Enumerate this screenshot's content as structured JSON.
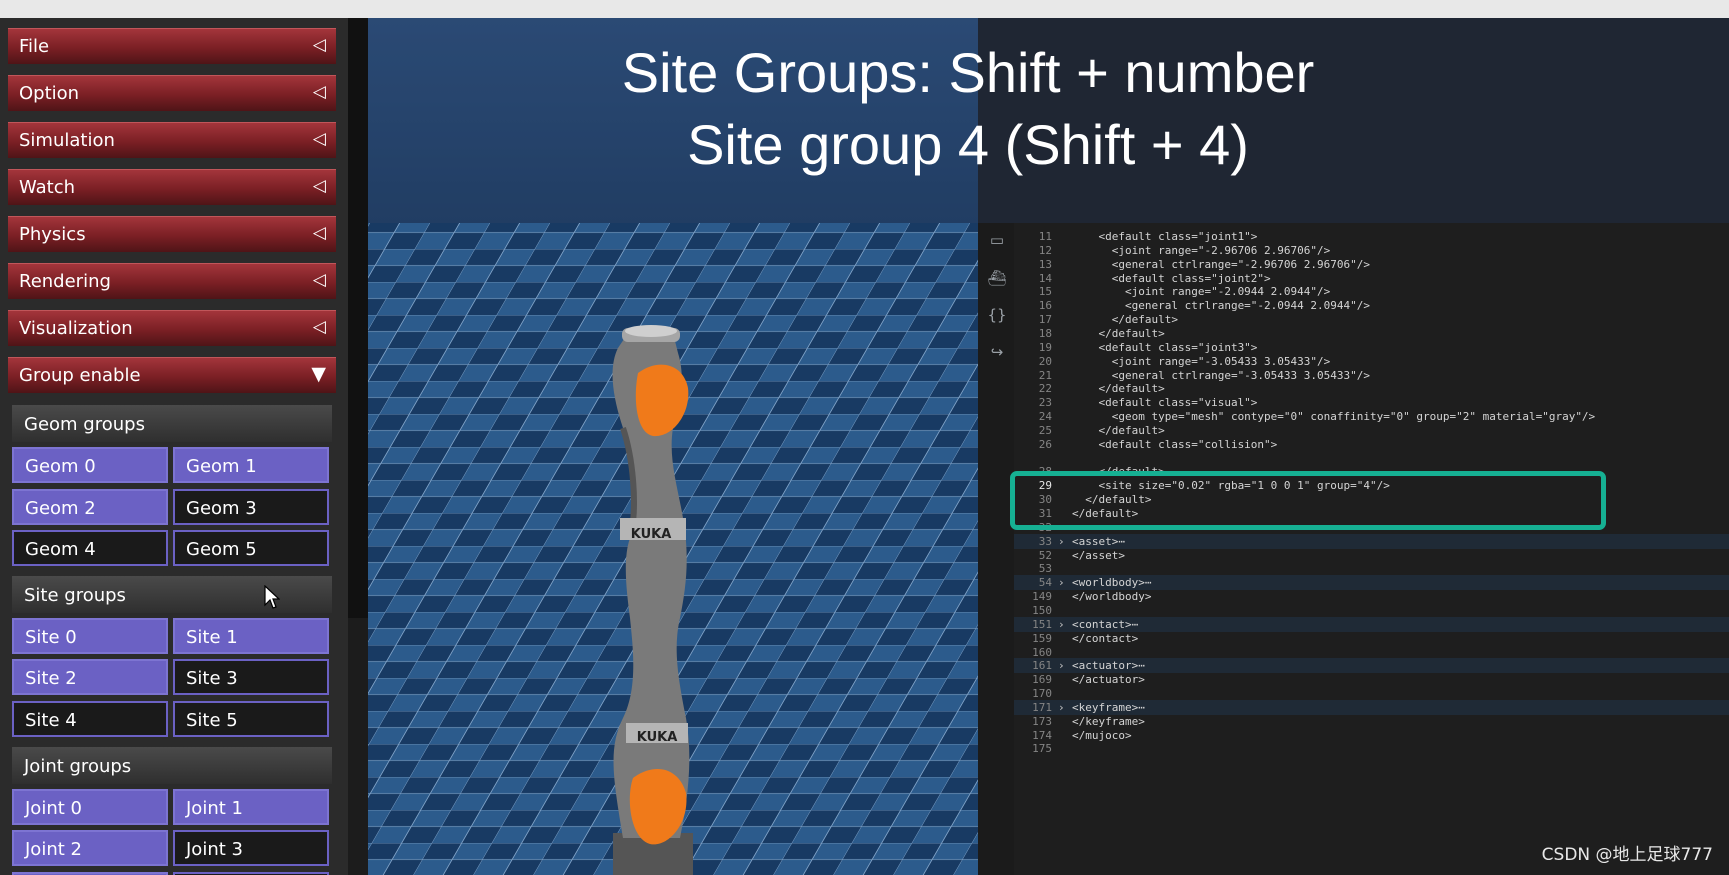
{
  "menu": [
    {
      "label": "File",
      "arrow": "◁"
    },
    {
      "label": "Option",
      "arrow": "◁"
    },
    {
      "label": "Simulation",
      "arrow": "◁"
    },
    {
      "label": "Watch",
      "arrow": "◁"
    },
    {
      "label": "Physics",
      "arrow": "◁"
    },
    {
      "label": "Rendering",
      "arrow": "◁"
    },
    {
      "label": "Visualization",
      "arrow": "◁"
    },
    {
      "label": "Group enable",
      "arrow": "▼"
    }
  ],
  "group_enable": {
    "geom_groups": {
      "header": "Geom groups",
      "buttons": [
        {
          "label": "Geom 0",
          "enabled": true
        },
        {
          "label": "Geom 1",
          "enabled": true
        },
        {
          "label": "Geom 2",
          "enabled": true
        },
        {
          "label": "Geom 3",
          "enabled": false
        },
        {
          "label": "Geom 4",
          "enabled": false
        },
        {
          "label": "Geom 5",
          "enabled": false
        }
      ]
    },
    "site_groups": {
      "header": "Site groups",
      "buttons": [
        {
          "label": "Site 0",
          "enabled": true
        },
        {
          "label": "Site 1",
          "enabled": true
        },
        {
          "label": "Site 2",
          "enabled": true
        },
        {
          "label": "Site 3",
          "enabled": false
        },
        {
          "label": "Site 4",
          "enabled": false
        },
        {
          "label": "Site 5",
          "enabled": false
        }
      ]
    },
    "joint_groups": {
      "header": "Joint groups",
      "buttons": [
        {
          "label": "Joint 0",
          "enabled": true
        },
        {
          "label": "Joint 1",
          "enabled": true
        },
        {
          "label": "Joint 2",
          "enabled": true
        },
        {
          "label": "Joint 3",
          "enabled": false
        }
      ]
    }
  },
  "overlay": {
    "line1": "Site Groups: Shift + number",
    "line2": "Site group 4 (Shift + 4)"
  },
  "robot": {
    "brand_upper": "KUKA",
    "brand_lower": "KUKA"
  },
  "editor": {
    "lines": [
      {
        "n": "11",
        "text": "    <default class=\"joint1\">"
      },
      {
        "n": "12",
        "text": "      <joint range=\"-2.96706 2.96706\"/>"
      },
      {
        "n": "13",
        "text": "      <general ctrlrange=\"-2.96706 2.96706\"/>"
      },
      {
        "n": "14",
        "text": "      <default class=\"joint2\">"
      },
      {
        "n": "15",
        "text": "        <joint range=\"-2.0944 2.0944\"/>"
      },
      {
        "n": "16",
        "text": "        <general ctrlrange=\"-2.0944 2.0944\"/>"
      },
      {
        "n": "17",
        "text": "      </default>"
      },
      {
        "n": "18",
        "text": "    </default>"
      },
      {
        "n": "19",
        "text": "    <default class=\"joint3\">"
      },
      {
        "n": "20",
        "text": "      <joint range=\"-3.05433 3.05433\"/>"
      },
      {
        "n": "21",
        "text": "      <general ctrlrange=\"-3.05433 3.05433\"/>"
      },
      {
        "n": "22",
        "text": "    </default>"
      },
      {
        "n": "23",
        "text": "    <default class=\"visual\">"
      },
      {
        "n": "24",
        "text": "      <geom type=\"mesh\" contype=\"0\" conaffinity=\"0\" group=\"2\" material=\"gray\"/>"
      },
      {
        "n": "25",
        "text": "    </default>"
      },
      {
        "n": "26",
        "text": "    <default class=\"collision\">"
      },
      {
        "n": "",
        "text": ""
      },
      {
        "n": "28",
        "text": "    </default>"
      },
      {
        "n": "29",
        "text": "    <site size=\"0.02\" rgba=\"1 0 0 1\" group=\"4\"/>",
        "current": true
      },
      {
        "n": "30",
        "text": "  </default>"
      },
      {
        "n": "31",
        "text": "</default>"
      },
      {
        "n": "32",
        "text": ""
      },
      {
        "n": "33",
        "text": "<asset>⋯",
        "fold": "›",
        "highlight": true
      },
      {
        "n": "52",
        "text": "</asset>"
      },
      {
        "n": "53",
        "text": ""
      },
      {
        "n": "54",
        "text": "<worldbody>⋯",
        "fold": "›",
        "highlight": true
      },
      {
        "n": "149",
        "text": "</worldbody>"
      },
      {
        "n": "150",
        "text": ""
      },
      {
        "n": "151",
        "text": "<contact>⋯",
        "fold": "›",
        "highlight": true
      },
      {
        "n": "159",
        "text": "</contact>"
      },
      {
        "n": "160",
        "text": ""
      },
      {
        "n": "161",
        "text": "<actuator>⋯",
        "fold": "›",
        "highlight": true
      },
      {
        "n": "169",
        "text": "</actuator>"
      },
      {
        "n": "170",
        "text": ""
      },
      {
        "n": "171",
        "text": "<keyframe>⋯",
        "fold": "›",
        "highlight": true
      },
      {
        "n": "173",
        "text": "</keyframe>"
      },
      {
        "n": "174",
        "text": "</mujoco>"
      },
      {
        "n": "175",
        "text": ""
      }
    ]
  },
  "watermark": "CSDN @地上足球777",
  "colors": {
    "menu_red": "#7a1f24",
    "toggle_on": "#6b61c4",
    "highlight_box": "#16b093",
    "robot_orange": "#f07a1a"
  }
}
